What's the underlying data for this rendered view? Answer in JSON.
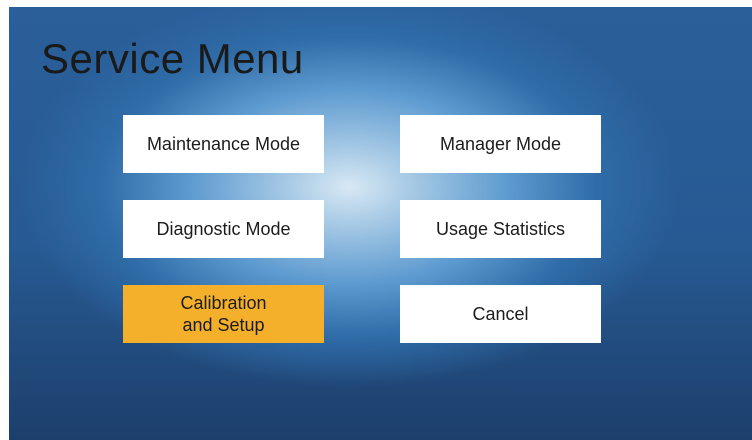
{
  "screen": {
    "title": "Service Menu"
  },
  "buttons": {
    "maintenance_mode": "Maintenance Mode",
    "manager_mode": "Manager Mode",
    "diagnostic_mode": "Diagnostic Mode",
    "usage_statistics": "Usage Statistics",
    "calibration_setup": "Calibration\nand Setup",
    "cancel": "Cancel"
  },
  "colors": {
    "selected_button": "#f4b02a",
    "button": "#ffffff",
    "background_dark": "#1d3f6c",
    "background_light": "#d8e8f4"
  },
  "state": {
    "selected": "calibration_setup"
  }
}
